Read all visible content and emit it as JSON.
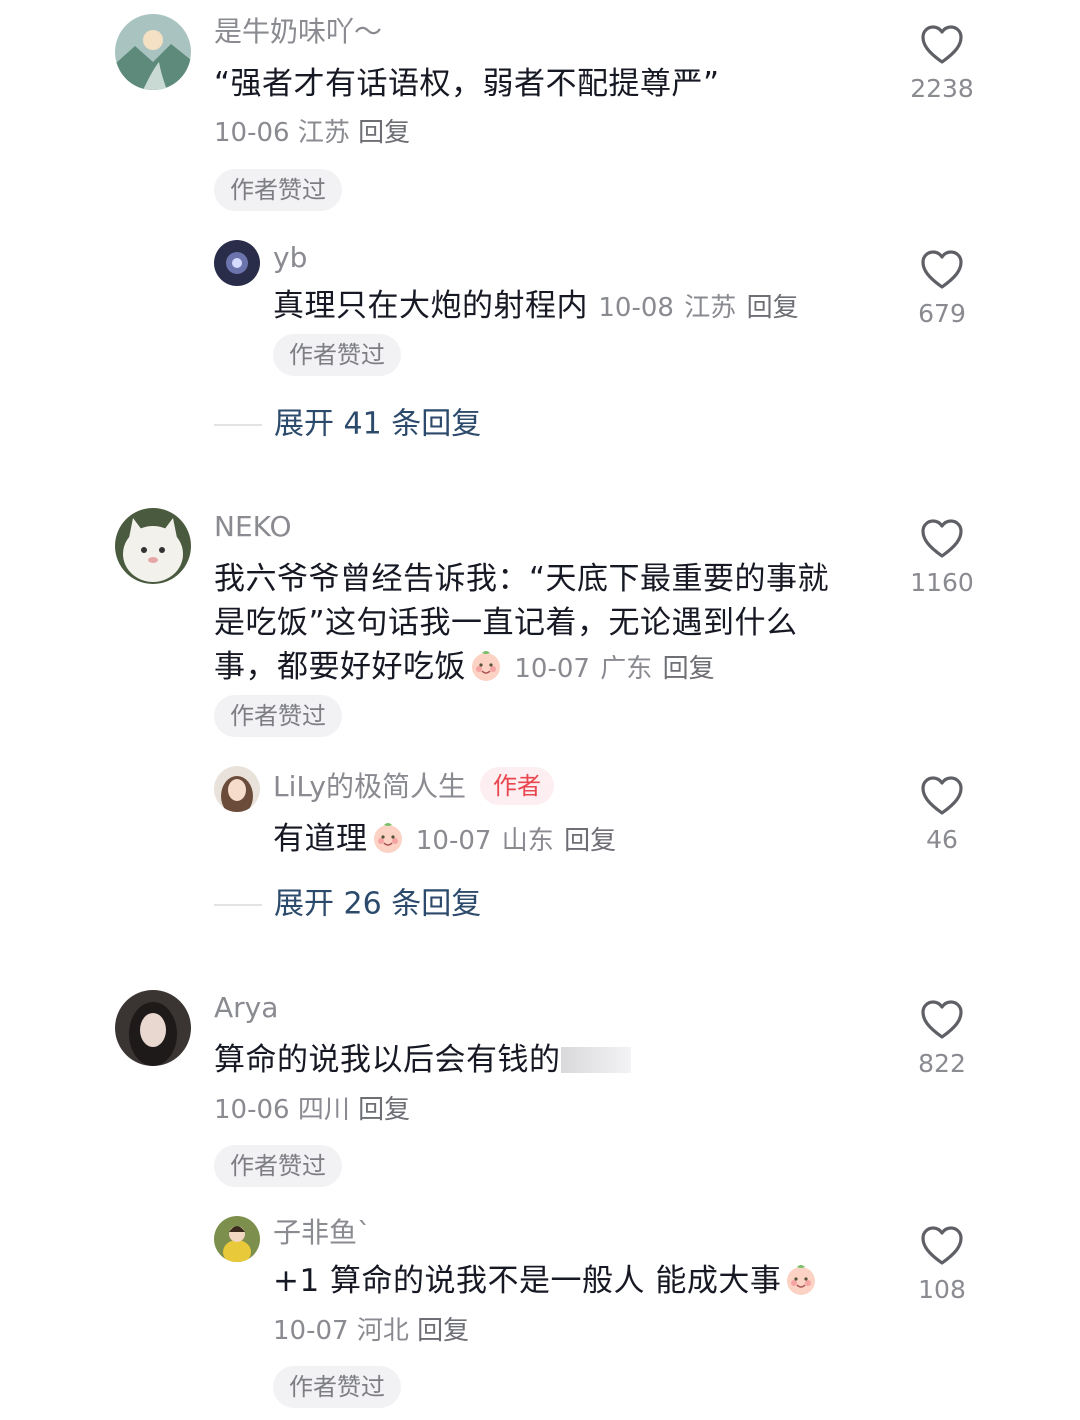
{
  "comments": [
    {
      "user": "是牛奶味吖～",
      "text": "“强者才有话语权，弱者不配提尊严”",
      "date": "10-06",
      "location": "江苏",
      "reply_label": "回复",
      "author_liked": "作者赞过",
      "likes": "2238",
      "sub_reply": {
        "user": "yb",
        "text": "真理只在大炮的射程内",
        "date": "10-08",
        "location": "江苏",
        "reply_label": "回复",
        "author_liked": "作者赞过",
        "likes": "679"
      },
      "expand": "展开 41 条回复"
    },
    {
      "user": "NEKO",
      "text": "我六爷爷曾经告诉我：“天底下最重要的事就是吃饭”这句话我一直记着，无论遇到什么事，都要好好吃饭",
      "emoji": "smile-face-emoji",
      "date": "10-07",
      "location": "广东",
      "reply_label": "回复",
      "author_liked": "作者赞过",
      "likes": "1160",
      "sub_reply": {
        "user": "LiLy的极简人生",
        "author_tag": "作者",
        "text": "有道理",
        "emoji": "thinking-face-emoji",
        "date": "10-07",
        "location": "山东",
        "reply_label": "回复",
        "likes": "46"
      },
      "expand": "展开 26 条回复"
    },
    {
      "user": "Arya",
      "text": "算命的说我以后会有钱的",
      "date": "10-06",
      "location": "四川",
      "reply_label": "回复",
      "author_liked": "作者赞过",
      "likes": "822",
      "sub_reply": {
        "user": "子非鱼`",
        "text": "+1 算命的说我不是一般人 能成大事",
        "emoji": "laugh-cry-face-emoji",
        "date": "10-07",
        "location": "河北",
        "reply_label": "回复",
        "author_liked": "作者赞过",
        "likes": "108"
      }
    }
  ],
  "colors": {
    "text": "#161823",
    "secondary": "#8a8b91",
    "expand_link": "#2c4a6b",
    "author_tag_bg": "#fdeef1",
    "author_tag_fg": "#e8474f",
    "badge_bg": "#f2f2f4"
  },
  "icons": {
    "like": "heart-outline-icon"
  }
}
